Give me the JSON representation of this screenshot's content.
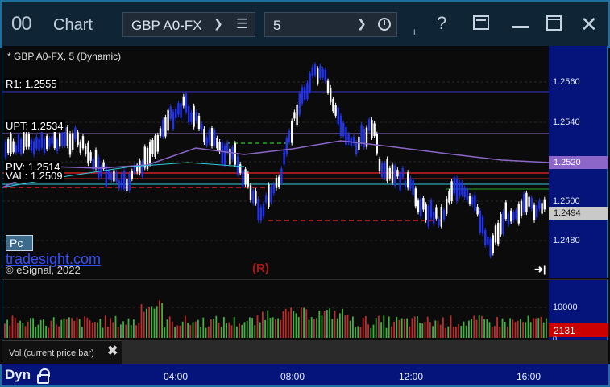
{
  "titlebar": {
    "app_title": "Chart",
    "app_icon": "00",
    "symbol": "GBP A0-FX",
    "interval": "5",
    "small_mark": "ι",
    "icons": [
      "chevron-down-icon",
      "menu-icon",
      "clock-icon",
      "help-icon",
      "layout-icon",
      "minimize-icon",
      "maximize-icon",
      "close-icon"
    ]
  },
  "chart": {
    "title": "* GBP A0-FX, 5 (Dynamic)",
    "levels": {
      "r1": "R1: 1.2555",
      "upt": "UPT: 1.2534",
      "piv": "PIV: 1.2514",
      "val": "VAL: 1.2509"
    },
    "badge": "Pc",
    "watermark": "tradesight.com",
    "copyright": "© eSignal, 2022",
    "marker": "(R)",
    "jump_icon": "jump-to-end-icon"
  },
  "price_axis": {
    "ticks": [
      "1.2560",
      "1.2540",
      "1.2520",
      "1.2500",
      "1.2480"
    ],
    "ma_tag": "1.2520",
    "last_tag": "1.2494"
  },
  "volume": {
    "tick": "10000",
    "zero": "0",
    "last_tag": "2131",
    "study_label": "Vol (current price bar)"
  },
  "time_axis": {
    "mode": "Dyn",
    "labels": [
      "04:00",
      "08:00",
      "12:00",
      "16:00"
    ]
  },
  "colors": {
    "up_candle": "#ffffff",
    "down_candle": "#2233ee",
    "ma_line": "#8c67c9",
    "level_line": "#cc2020",
    "vol_up": "#3fb13f",
    "vol_down": "#c12b2b",
    "axis_bg": "#04147a"
  }
}
